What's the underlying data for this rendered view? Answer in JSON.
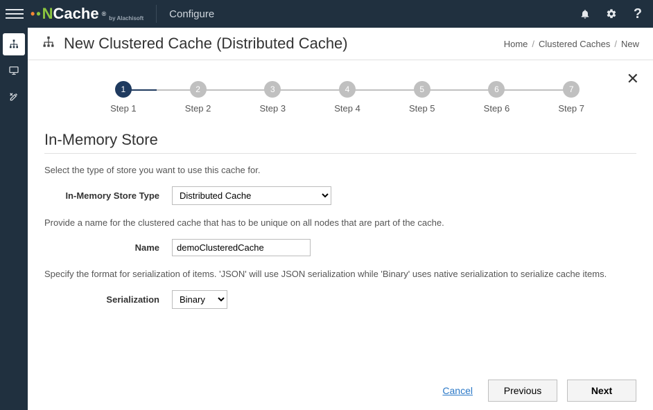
{
  "topbar": {
    "brand_main": "Cache",
    "brand_sub": "by Alachisoft",
    "app_title": "Configure"
  },
  "sidebar": {
    "items": [
      {
        "id": "clustered-caches",
        "icon": "cluster",
        "active": true
      },
      {
        "id": "local-caches",
        "icon": "monitor",
        "active": false
      },
      {
        "id": "tools",
        "icon": "tools",
        "active": false
      }
    ]
  },
  "page_header": {
    "title": "New Clustered Cache (Distributed Cache)"
  },
  "breadcrumb": {
    "items": [
      {
        "label": "Home",
        "link": true
      },
      {
        "label": "Clustered Caches",
        "link": true
      },
      {
        "label": "New",
        "link": false
      }
    ]
  },
  "wizard": {
    "current": 1,
    "steps": [
      {
        "num": "1",
        "label": "Step 1"
      },
      {
        "num": "2",
        "label": "Step 2"
      },
      {
        "num": "3",
        "label": "Step 3"
      },
      {
        "num": "4",
        "label": "Step 4"
      },
      {
        "num": "5",
        "label": "Step 5"
      },
      {
        "num": "6",
        "label": "Step 6"
      },
      {
        "num": "7",
        "label": "Step 7"
      }
    ]
  },
  "section": {
    "title": "In-Memory Store",
    "store_type": {
      "hint": "Select the type of store you want to use this cache for.",
      "label": "In-Memory Store Type",
      "value": "Distributed Cache"
    },
    "name": {
      "hint": "Provide a name for the clustered cache that has to be unique on all nodes that are part of the cache.",
      "label": "Name",
      "value": "demoClusteredCache"
    },
    "serialization": {
      "hint": "Specify the format for serialization of items. 'JSON' will use JSON serialization while 'Binary' uses native serialization to serialize cache items.",
      "label": "Serialization",
      "value": "Binary"
    }
  },
  "footer": {
    "cancel_label": "Cancel",
    "previous_label": "Previous",
    "next_label": "Next"
  }
}
